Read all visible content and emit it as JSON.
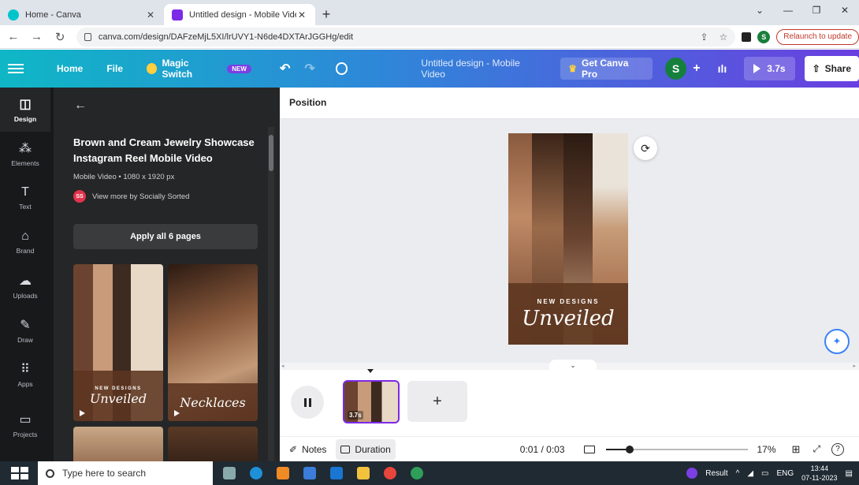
{
  "browser": {
    "tabs": [
      {
        "label": "Home - Canva",
        "active": false
      },
      {
        "label": "Untitled design - Mobile Video",
        "active": true
      }
    ],
    "url": "canva.com/design/DAFzeMjL5XI/lrUVY1-N6de4DXTArJGGHg/edit",
    "profile_initial": "S",
    "relaunch_label": "Relaunch to update"
  },
  "topbar": {
    "home": "Home",
    "file": "File",
    "magic_switch": "Magic Switch",
    "new_badge": "NEW",
    "design_title": "Untitled design - Mobile Video",
    "get_pro": "Get Canva Pro",
    "avatar_initial": "S",
    "play_duration": "3.7s",
    "share": "Share"
  },
  "rail": [
    {
      "label": "Design",
      "icon": "design-icon",
      "active": true
    },
    {
      "label": "Elements",
      "icon": "elements-icon",
      "active": false
    },
    {
      "label": "Text",
      "icon": "text-icon",
      "active": false
    },
    {
      "label": "Brand",
      "icon": "brand-icon",
      "active": false
    },
    {
      "label": "Uploads",
      "icon": "uploads-icon",
      "active": false
    },
    {
      "label": "Draw",
      "icon": "draw-icon",
      "active": false
    },
    {
      "label": "Apps",
      "icon": "apps-icon",
      "active": false
    },
    {
      "label": "Projects",
      "icon": "projects-icon",
      "active": false
    }
  ],
  "panel": {
    "title": "Brown and Cream Jewelry Showcase Instagram Reel Mobile Video",
    "meta": "Mobile Video • 1080 x 1920 px",
    "creator_initials": "SS",
    "creator_link": "View more by Socially Sorted",
    "apply_button": "Apply all 6 pages",
    "thumbnails": [
      {
        "small": "NEW DESIGNS",
        "script": "Unveiled"
      },
      {
        "small": "",
        "script": "Necklaces"
      }
    ]
  },
  "toolbar": {
    "position": "Position"
  },
  "design": {
    "small_text": "NEW DESIGNS",
    "script_text": "Unveiled"
  },
  "timeline": {
    "clip_duration": "3.7s",
    "add_page": "+"
  },
  "footer": {
    "notes": "Notes",
    "duration": "Duration",
    "time": "0:01 / 0:03",
    "zoom": "17%",
    "zoom_fraction": 0.17
  },
  "taskbar": {
    "search_placeholder": "Type here to search",
    "result_label": "Result",
    "language": "ENG",
    "time": "13:44",
    "date": "07-11-2023"
  },
  "colors": {
    "canva_gradient_start": "#0fb7c6",
    "canva_gradient_end": "#6a3fe0",
    "accent_purple": "#7d2ae8",
    "panel_bg": "#252627",
    "rail_bg": "#18191b"
  }
}
